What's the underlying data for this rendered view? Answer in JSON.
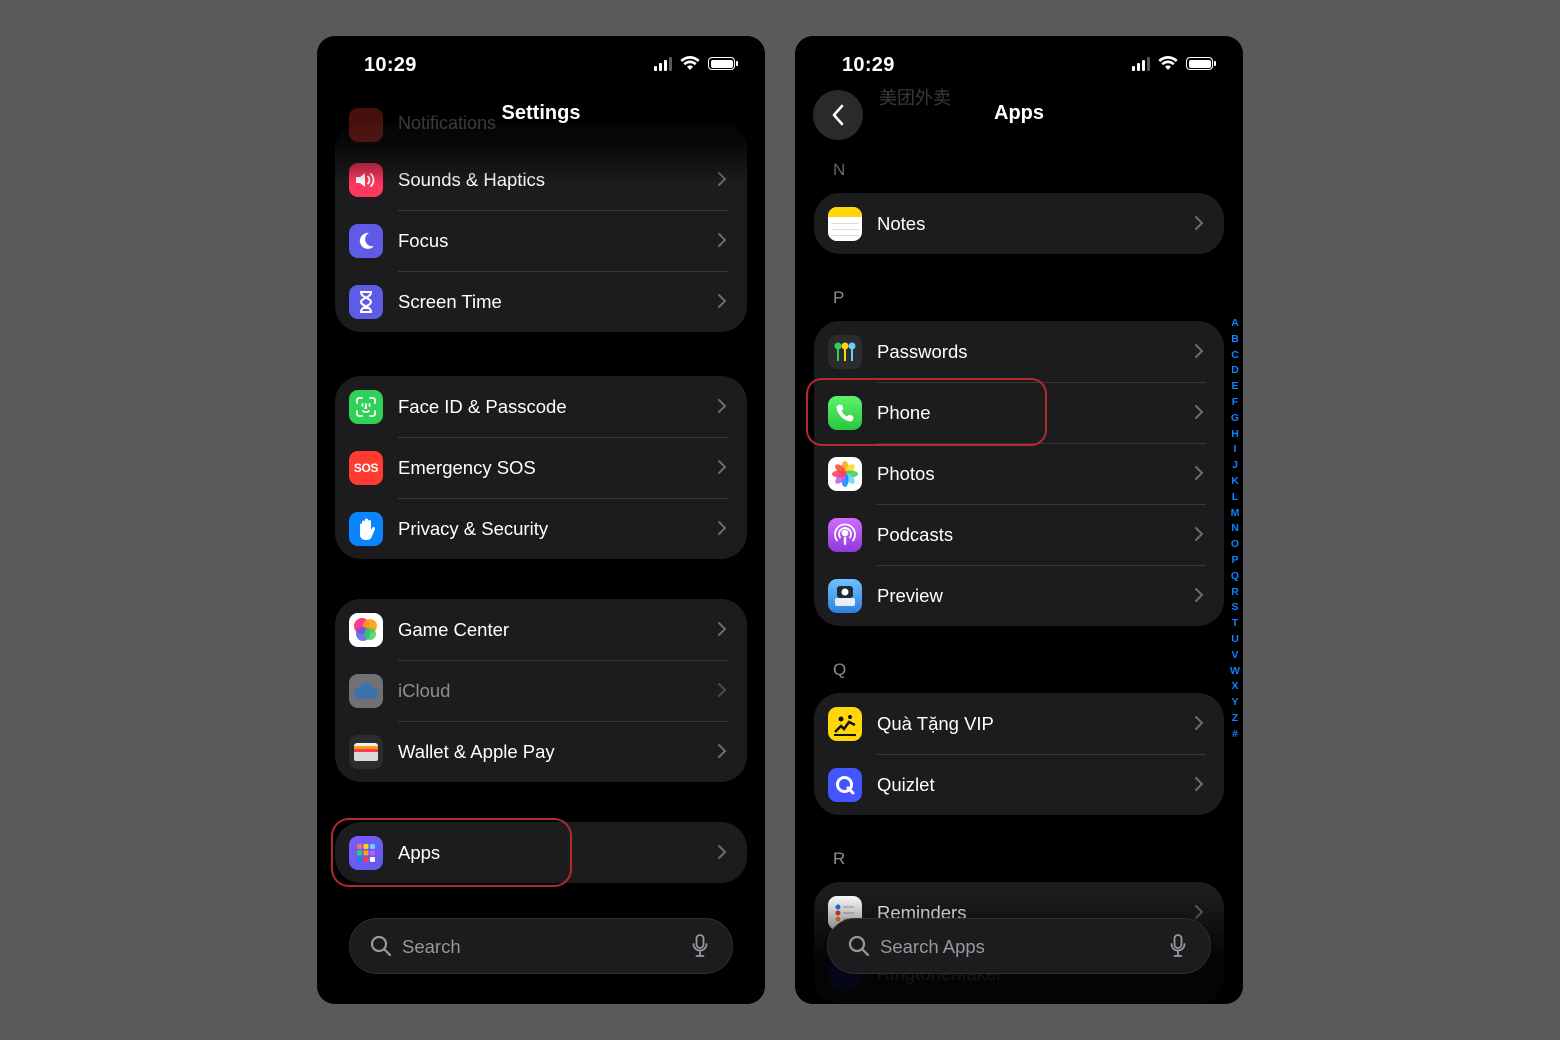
{
  "status": {
    "time": "10:29"
  },
  "left": {
    "title": "Settings",
    "ghost_row": "Notifications",
    "groups": [
      {
        "items": [
          {
            "label": "Sounds & Haptics",
            "icon": "speaker-icon",
            "color": "#ff375f"
          },
          {
            "label": "Focus",
            "icon": "moon-icon",
            "color": "#5e5ce6"
          },
          {
            "label": "Screen Time",
            "icon": "hourglass-icon",
            "color": "#5e5ce6"
          }
        ]
      },
      {
        "items": [
          {
            "label": "Face ID & Passcode",
            "icon": "face-id-icon",
            "color": "#30d158"
          },
          {
            "label": "Emergency SOS",
            "icon": "sos-icon",
            "icon_text": "SOS",
            "color": "#ff3b30"
          },
          {
            "label": "Privacy & Security",
            "icon": "hand-icon",
            "color": "#0a84ff"
          }
        ]
      },
      {
        "items": [
          {
            "label": "Game Center",
            "icon": "game-center-icon",
            "color": "#ffffff"
          },
          {
            "label": "iCloud",
            "icon": "cloud-icon",
            "color": "#8e8e93"
          },
          {
            "label": "Wallet & Apple Pay",
            "icon": "wallet-icon",
            "color": "#2c2c2e"
          }
        ]
      },
      {
        "items": [
          {
            "label": "Apps",
            "icon": "apps-grid-icon",
            "color": "#5e5ce6"
          }
        ]
      }
    ],
    "search_placeholder": "Search"
  },
  "right": {
    "title": "Apps",
    "ghost_row": "美团外卖",
    "sections": [
      {
        "letter": "N",
        "items": [
          {
            "label": "Notes",
            "icon": "notes-icon"
          }
        ]
      },
      {
        "letter": "P",
        "items": [
          {
            "label": "Passwords",
            "icon": "passwords-icon"
          },
          {
            "label": "Phone",
            "icon": "phone-icon"
          },
          {
            "label": "Photos",
            "icon": "photos-icon"
          },
          {
            "label": "Podcasts",
            "icon": "podcasts-icon"
          },
          {
            "label": "Preview",
            "icon": "preview-icon"
          }
        ]
      },
      {
        "letter": "Q",
        "items": [
          {
            "label": "Quà Tặng VIP",
            "icon": "qua-tang-vip-icon"
          },
          {
            "label": "Quizlet",
            "icon": "quizlet-icon"
          }
        ]
      },
      {
        "letter": "R",
        "items": [
          {
            "label": "Reminders",
            "icon": "reminders-icon"
          },
          {
            "label": "RingtoneMaker",
            "icon": "ringtone-maker-icon"
          }
        ]
      }
    ],
    "search_placeholder": "Search Apps",
    "index_letters": [
      "A",
      "B",
      "C",
      "D",
      "E",
      "F",
      "G",
      "H",
      "I",
      "J",
      "K",
      "L",
      "M",
      "N",
      "O",
      "P",
      "Q",
      "R",
      "S",
      "T",
      "U",
      "V",
      "W",
      "X",
      "Y",
      "Z",
      "#"
    ]
  },
  "highlight_color": "#b02a2f"
}
